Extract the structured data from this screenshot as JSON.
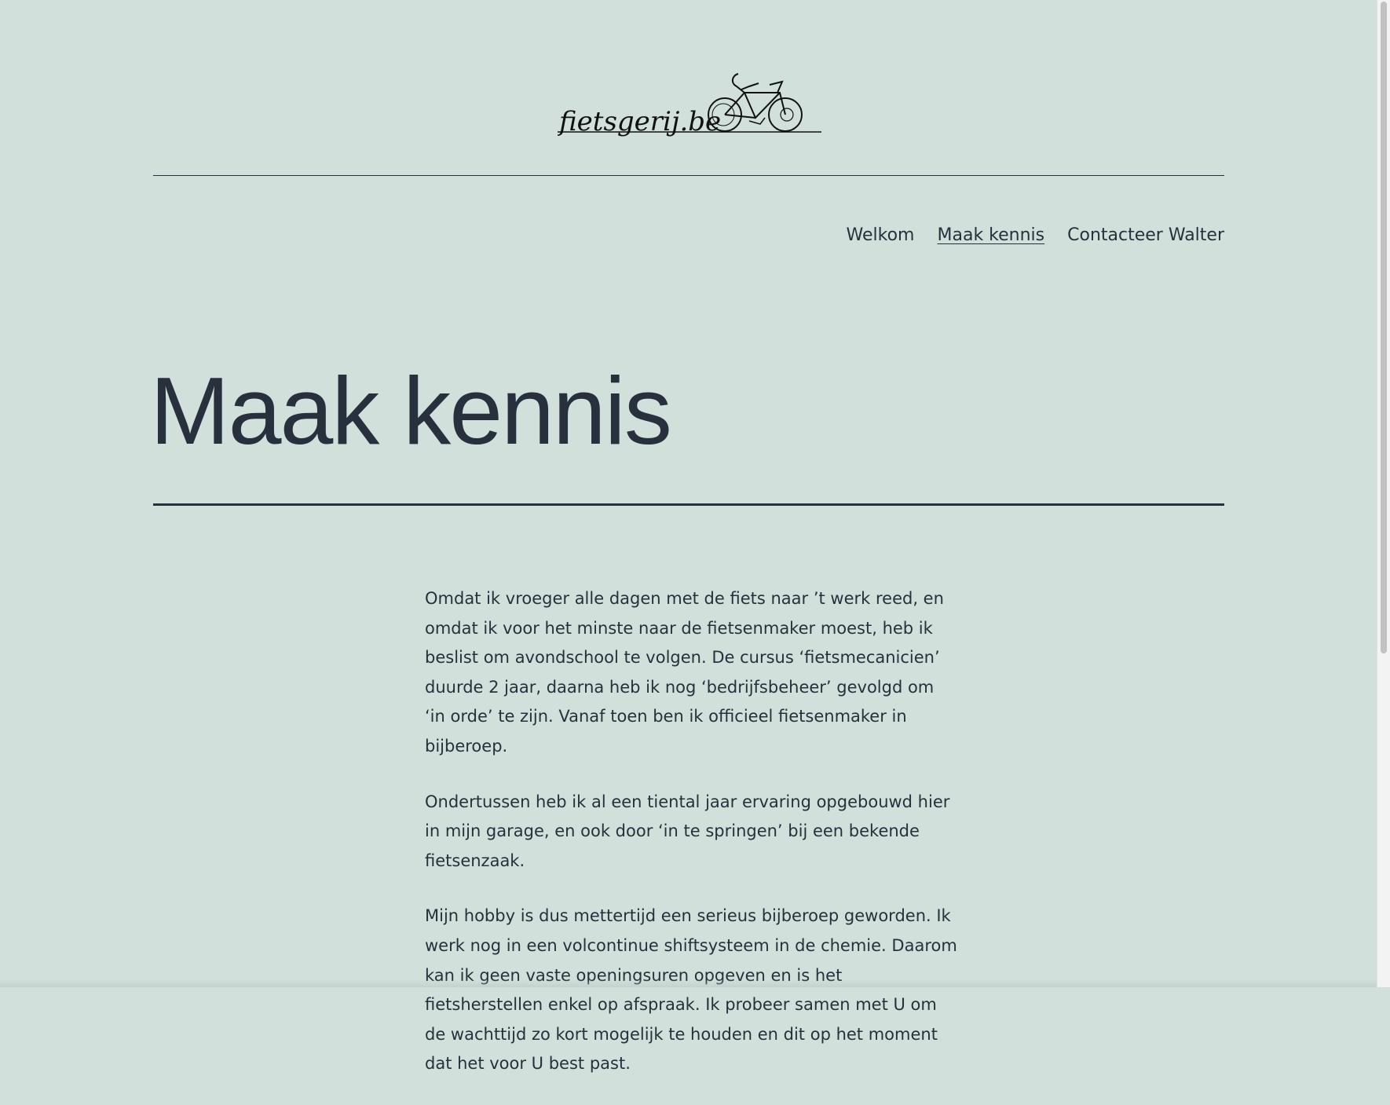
{
  "logo": {
    "text": "fietsgerij.be",
    "icon": "bicycle-icon"
  },
  "nav": {
    "items": [
      {
        "label": "Welkom"
      },
      {
        "label": "Maak kennis"
      },
      {
        "label": "Contacteer Walter"
      }
    ]
  },
  "main": {
    "title": "Maak kennis",
    "paragraphs": [
      " Omdat ik vroeger alle dagen met de fiets naar ’t werk reed, en omdat ik voor het minste naar de fietsenmaker moest, heb ik beslist om avondschool te volgen. De cursus ‘fietsmecanicien’ duurde 2 jaar, daarna heb ik nog ‘bedrijfsbeheer’ gevolgd om ‘in orde’ te zijn. Vanaf toen ben ik officieel fietsenmaker in bijberoep.",
      "Ondertussen heb ik al een tiental jaar ervaring opgebouwd hier in mijn garage, en ook door ‘in te springen’ bij een bekende fietsenzaak.",
      "Mijn hobby is dus mettertijd een serieus bijberoep geworden.  Ik werk nog in een volcontinue shiftsysteem in de chemie. Daarom kan ik geen vaste openingsuren opgeven en is het fietsherstellen enkel op afspraak. Ik probeer samen met U om de wachttijd zo kort mogelijk te houden en dit op het moment dat het voor U best past."
    ]
  },
  "colors": {
    "background": "#d1e0db",
    "text": "#28303d"
  }
}
